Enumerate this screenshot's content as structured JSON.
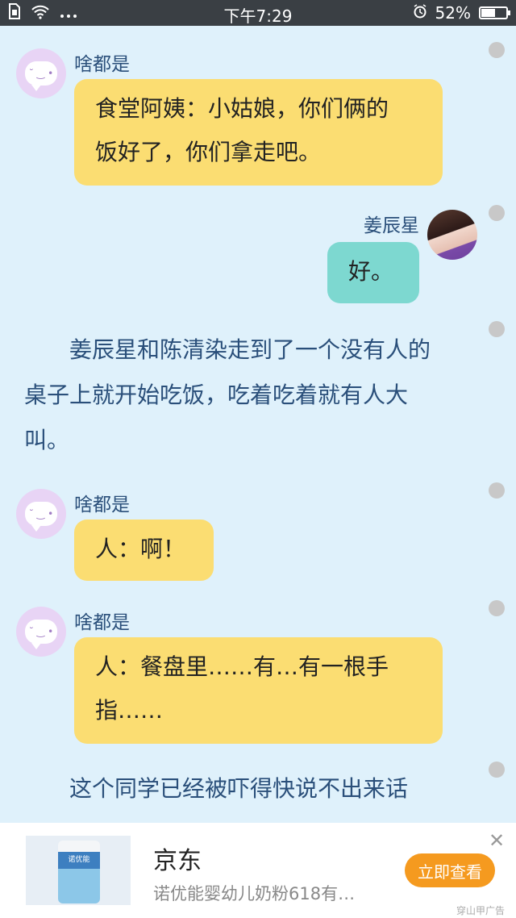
{
  "status_bar": {
    "time": "下午7:29",
    "battery_percent": "52%",
    "battery_level": 0.52,
    "left_icons": [
      "sim-icon",
      "wifi-icon",
      "more-icon"
    ],
    "right_icons": [
      "alarm-icon",
      "battery-icon"
    ]
  },
  "messages": [
    {
      "type": "left",
      "name": "啥都是",
      "lines": [
        "食堂阿姨：小姑娘，你们俩的",
        "饭好了，你们拿走吧。"
      ]
    },
    {
      "type": "right",
      "name": "姜辰星",
      "lines": [
        "好。"
      ]
    },
    {
      "type": "narration",
      "lines": [
        "姜辰星和陈清染走到了一个没有人的",
        "桌子上就开始吃饭，吃着吃着就有人大",
        "叫。"
      ]
    },
    {
      "type": "left",
      "name": "啥都是",
      "lines": [
        "人：啊！"
      ]
    },
    {
      "type": "left",
      "name": "啥都是",
      "lines": [
        "人：餐盘里……有…有一根手",
        "指……"
      ]
    },
    {
      "type": "narration",
      "lines": [
        "这个同学已经被吓得快说不出来话"
      ]
    }
  ],
  "ad": {
    "title": "京东",
    "description": "诺优能婴幼儿奶粉618有…",
    "button_label": "立即查看",
    "source": "穿山甲广告",
    "close_glyph": "✕",
    "product_label": "诺优能",
    "accent_color": "#f59a1f"
  },
  "colors": {
    "background": "#dff1fb",
    "left_bubble": "#fbdd72",
    "right_bubble": "#7dd8d0",
    "name_text": "#2a4f7a"
  }
}
